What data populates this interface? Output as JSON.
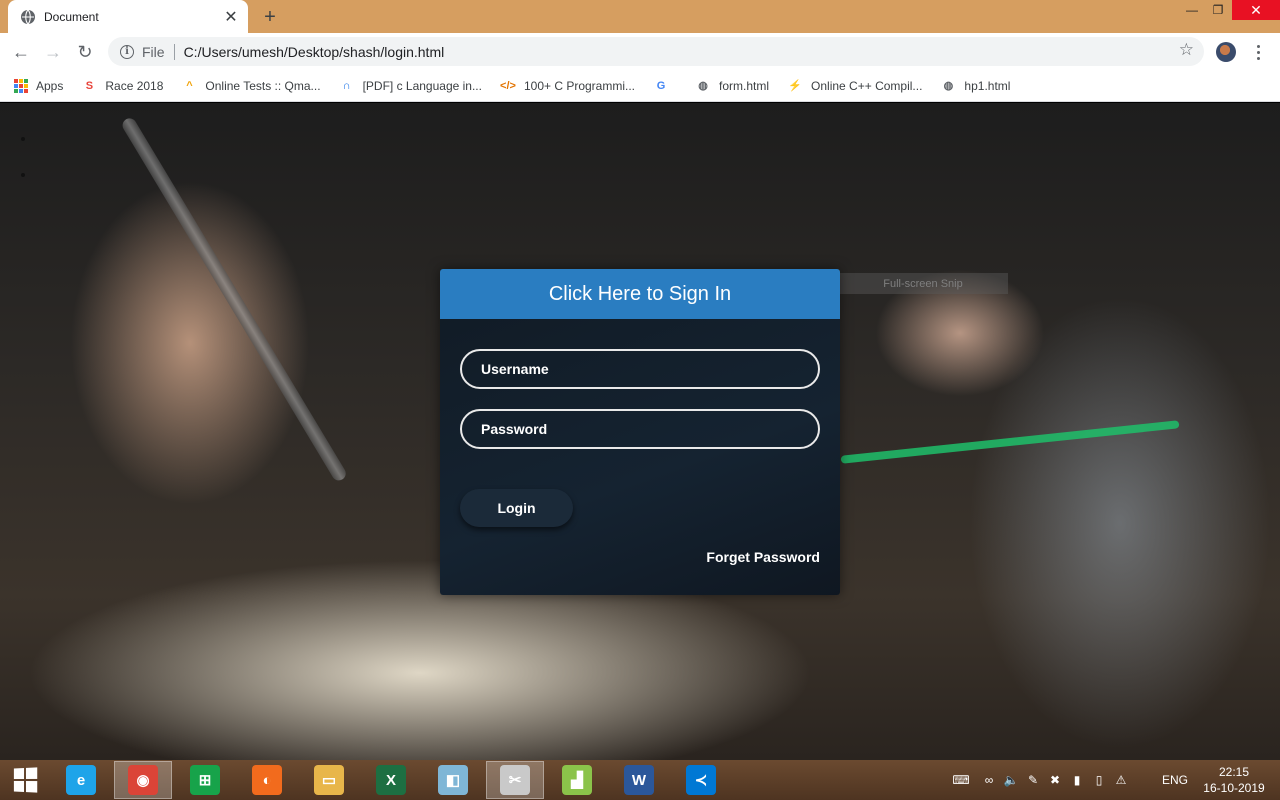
{
  "browser": {
    "tab_title": "Document",
    "new_tab_symbol": "+",
    "omnibox_scheme": "File",
    "url": "C:/Users/umesh/Desktop/shash/login.html",
    "bookmarks": [
      {
        "label": "Apps",
        "icon": "apps-grid-icon"
      },
      {
        "label": "Race 2018",
        "icon": "race-s-icon",
        "glyph": "S",
        "color": "#e8453c"
      },
      {
        "label": "Online Tests :: Qma...",
        "icon": "qmaths-icon",
        "glyph": "^",
        "color": "#f0a30a"
      },
      {
        "label": "[PDF] c Language in...",
        "icon": "pdf-icon",
        "glyph": "∩",
        "color": "#1a73e8"
      },
      {
        "label": "100+ C Programmi...",
        "icon": "code-icon",
        "glyph": "</>",
        "color": "#e37400"
      },
      {
        "label": "",
        "icon": "google-icon",
        "glyph": "G",
        "color": "#4285f4"
      },
      {
        "label": "form.html",
        "icon": "globe-icon",
        "glyph": "◍",
        "color": "#5f6368"
      },
      {
        "label": "Online C++ Compil...",
        "icon": "bolt-icon",
        "glyph": "⚡",
        "color": "#5f3dc4"
      },
      {
        "label": "hp1.html",
        "icon": "globe-icon",
        "glyph": "◍",
        "color": "#5f6368"
      }
    ]
  },
  "page": {
    "bullets": [
      "",
      ""
    ],
    "snip_tooltip": "Full-screen Snip",
    "login": {
      "header": "Click Here to Sign In",
      "username_placeholder": "Username",
      "password_placeholder": "Password",
      "login_button": "Login",
      "forget_link": "Forget Password"
    }
  },
  "taskbar": {
    "apps": [
      {
        "name": "internet-explorer-icon",
        "glyph": "e",
        "color": "#1ea4e9"
      },
      {
        "name": "chrome-icon",
        "glyph": "◉",
        "color": "#db4437",
        "active": true
      },
      {
        "name": "store-icon",
        "glyph": "⊞",
        "color": "#17a34a"
      },
      {
        "name": "firefox-icon",
        "glyph": "◐",
        "color": "#f26b1d"
      },
      {
        "name": "file-explorer-icon",
        "glyph": "▭",
        "color": "#e8b64a"
      },
      {
        "name": "excel-icon",
        "glyph": "X",
        "color": "#1d6f42"
      },
      {
        "name": "eraser-icon",
        "glyph": "◧",
        "color": "#7fb6d6"
      },
      {
        "name": "snipping-tool-icon",
        "glyph": "✂",
        "color": "#c9c9c9",
        "active": true
      },
      {
        "name": "chart-app-icon",
        "glyph": "▟",
        "color": "#8bc34a"
      },
      {
        "name": "word-icon",
        "glyph": "W",
        "color": "#2b579a"
      },
      {
        "name": "vscode-icon",
        "glyph": "≺",
        "color": "#0078d4"
      }
    ],
    "language": "ENG",
    "time": "22:15",
    "date": "16-10-2019"
  }
}
